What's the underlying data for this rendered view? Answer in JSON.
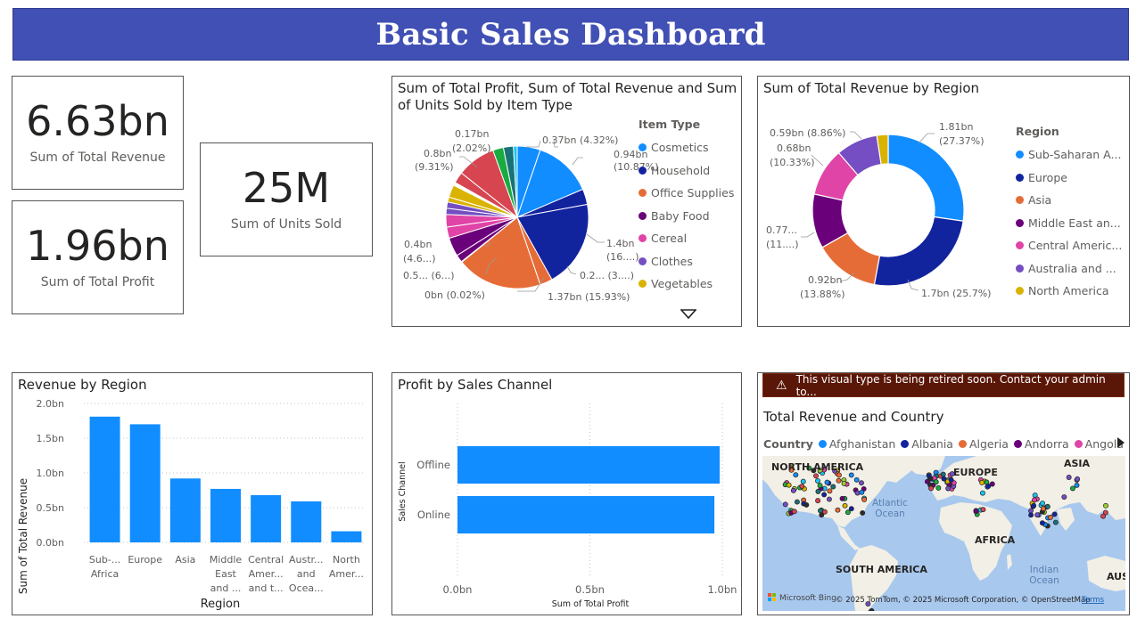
{
  "header": {
    "title": "Basic Sales Dashboard"
  },
  "kpis": {
    "revenue": {
      "value": "6.63bn",
      "label": "Sum of Total Revenue"
    },
    "profit": {
      "value": "1.96bn",
      "label": "Sum of Total Profit"
    },
    "units": {
      "value": "25M",
      "label": "Sum of Units Sold"
    }
  },
  "pie_item": {
    "title": "Sum of Total Profit, Sum of Total Revenue and Sum of Units Sold by Item Type",
    "legend_title": "Item Type",
    "legend": [
      {
        "label": "Cosmetics",
        "color": "#118DFF"
      },
      {
        "label": "Household",
        "color": "#12239E"
      },
      {
        "label": "Office Supplies",
        "color": "#E66C37"
      },
      {
        "label": "Baby Food",
        "color": "#6B007B"
      },
      {
        "label": "Cereal",
        "color": "#E044A7"
      },
      {
        "label": "Clothes",
        "color": "#744EC2"
      },
      {
        "label": "Vegetables",
        "color": "#D9B300"
      }
    ],
    "labels": [
      "0.37bn (4.32%)",
      "0.94bn",
      "(10.87%)",
      "1.4bn",
      "(16....)",
      "0.2... (3....)",
      "1.37bn (15.93%)",
      "0bn (0.02%)",
      "0.5... (6...)",
      "0.4bn",
      "(4.6...)",
      "0.8bn",
      "(9.31%)",
      "0.17bn",
      "(2.02%)"
    ],
    "more_icon": "triangle-down-icon"
  },
  "donut_region": {
    "title": "Sum of Total Revenue by Region",
    "legend_title": "Region",
    "legend": [
      {
        "label": "Sub-Saharan A...",
        "color": "#118DFF"
      },
      {
        "label": "Europe",
        "color": "#12239E"
      },
      {
        "label": "Asia",
        "color": "#E66C37"
      },
      {
        "label": "Middle East an...",
        "color": "#6B007B"
      },
      {
        "label": "Central Americ...",
        "color": "#E044A7"
      },
      {
        "label": "Australia and ...",
        "color": "#744EC2"
      },
      {
        "label": "North America",
        "color": "#D9B300"
      }
    ],
    "labels": [
      "1.81bn",
      "(27.37%)",
      "1.7bn (25.7%)",
      "0.92bn",
      "(13.88%)",
      "0.77...",
      "(11....)",
      "0.68bn",
      "(10.33%)",
      "0.59bn (8.86%)"
    ]
  },
  "bar_region": {
    "title": "Revenue by Region",
    "xlabel": "Region",
    "ylabel": "Sum of Total Revenue",
    "yticks": [
      "2.0bn",
      "1.5bn",
      "1.0bn",
      "0.5bn",
      "0.0bn"
    ],
    "cat_labels": [
      [
        "Sub-...",
        "Africa"
      ],
      [
        "Europe"
      ],
      [
        "Asia"
      ],
      [
        "Middle",
        "East",
        "and ..."
      ],
      [
        "Central",
        "Amer...",
        "and t..."
      ],
      [
        "Austr...",
        "and",
        "Ocea..."
      ],
      [
        "North",
        "Amer..."
      ]
    ]
  },
  "bar_channel": {
    "title": "Profit by Sales Channel",
    "xlabel": "Sum of Total Profit",
    "ylabel": "Sales Channel",
    "xticks": [
      "0.0bn",
      "0.5bn",
      "1.0bn"
    ]
  },
  "map": {
    "warning": "This visual type is being retired soon. Contact your admin to...",
    "warning_icon": "warning-icon",
    "title": "Total Revenue and Country",
    "legend_title": "Country",
    "legend": [
      {
        "label": "Afghanistan",
        "color": "#118DFF"
      },
      {
        "label": "Albania",
        "color": "#12239E"
      },
      {
        "label": "Algeria",
        "color": "#E66C37"
      },
      {
        "label": "Andorra",
        "color": "#6B007B"
      },
      {
        "label": "Angola",
        "color": "#E044A7"
      }
    ],
    "places": [
      "NORTH AMERICA",
      "EUROPE",
      "ASIA",
      "Atlantic",
      "Ocean",
      "AFRICA",
      "SOUTH AMERICA",
      "Indian",
      "Ocean",
      "AUSTF"
    ],
    "attribution": "© 2025 TomTom, © 2025 Microsoft Corporation, © OpenStreetMap",
    "terms": "Terms",
    "bing": "Microsoft Bing"
  },
  "chart_data": [
    {
      "type": "pie",
      "title": "Sum of Total Profit, Sum of Total Revenue and Sum of Units Sold by Item Type",
      "categories": [
        "Cosmetics",
        "Household",
        "Office Supplies",
        "Baby Food",
        "Cereal",
        "Clothes",
        "Vegetables"
      ],
      "slices": [
        {
          "value": 0.37,
          "color": "#118DFF"
        },
        {
          "value": 0.94,
          "color": "#118DFF"
        },
        {
          "value": 0.25,
          "color": "#12239E"
        },
        {
          "value": 1.4,
          "color": "#12239E"
        },
        {
          "value": 0.2,
          "color": "#E66C37"
        },
        {
          "value": 1.37,
          "color": "#E66C37"
        },
        {
          "value": 0.01,
          "color": "#6B007B"
        },
        {
          "value": 0.12,
          "color": "#6B007B"
        },
        {
          "value": 0.3,
          "color": "#6B007B"
        },
        {
          "value": 0.18,
          "color": "#E044A7"
        },
        {
          "value": 0.2,
          "color": "#E044A7"
        },
        {
          "value": 0.1,
          "color": "#744EC2"
        },
        {
          "value": 0.1,
          "color": "#744EC2"
        },
        {
          "value": 0.08,
          "color": "#D9B300"
        },
        {
          "value": 0.2,
          "color": "#D9B300"
        },
        {
          "value": 0.05,
          "color": "#FFFFFF"
        },
        {
          "value": 0.18,
          "color": "#D64550"
        },
        {
          "value": 0.62,
          "color": "#D64550"
        },
        {
          "value": 0.17,
          "color": "#1AAB40"
        },
        {
          "value": 0.16,
          "color": "#197278"
        },
        {
          "value": 0.06,
          "color": "#15C6F4"
        }
      ]
    },
    {
      "type": "pie",
      "title": "Sum of Total Revenue by Region",
      "categories": [
        "Sub-Saharan A...",
        "Europe",
        "Asia",
        "Middle East an...",
        "Central Americ...",
        "Australia and ...",
        "North America"
      ],
      "values": [
        1.81,
        1.7,
        0.92,
        0.77,
        0.68,
        0.59,
        0.16
      ],
      "colors": [
        "#118DFF",
        "#12239E",
        "#E66C37",
        "#6B007B",
        "#E044A7",
        "#744EC2",
        "#D9B300"
      ]
    },
    {
      "type": "bar",
      "title": "Revenue by Region",
      "categories": [
        "Sub-Saharan Africa",
        "Europe",
        "Asia",
        "Middle East and North Africa",
        "Central America and the Caribbean",
        "Australia and Oceania",
        "North America"
      ],
      "values": [
        1.81,
        1.7,
        0.92,
        0.77,
        0.68,
        0.59,
        0.16
      ],
      "xlabel": "Region",
      "ylabel": "Sum of Total Revenue",
      "ylim": [
        0,
        2.0
      ]
    },
    {
      "type": "bar",
      "title": "Profit by Sales Channel",
      "categories": [
        "Offline",
        "Online"
      ],
      "values": [
        0.99,
        0.97
      ],
      "xlabel": "Sum of Total Profit",
      "ylabel": "Sales Channel",
      "xlim": [
        0,
        1.0
      ]
    }
  ]
}
